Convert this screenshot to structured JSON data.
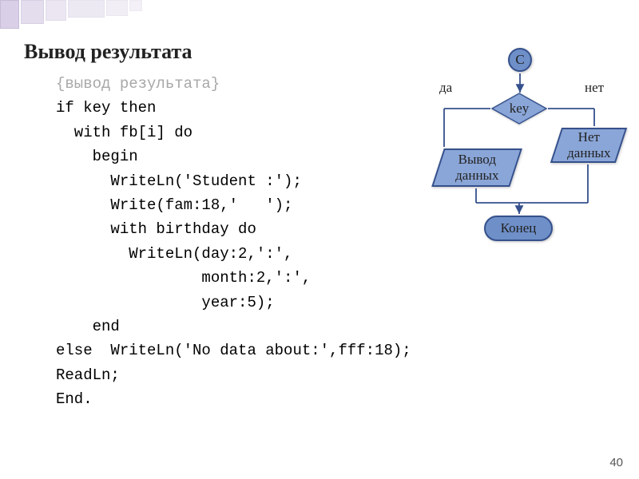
{
  "title": "Вывод результата",
  "code_lines": {
    "l1": "{вывод результата}",
    "l2": "if key then",
    "l3": "  with fb[i] do",
    "l4": "    begin",
    "l5": "      WriteLn('Student :');",
    "l6": "      Write(fam:18,'   ');",
    "l7": "      with birthday do",
    "l8": "        WriteLn(day:2,':',",
    "l9": "                month:2,':',",
    "l10": "                year:5);",
    "l11": "    end",
    "l12": "else  WriteLn('No data about:',fff:18);",
    "l13": "ReadLn;",
    "l14": "End."
  },
  "flow": {
    "connector": "С",
    "decision": "key",
    "yes_label": "да",
    "no_label": "нет",
    "output_box": "Вывод\nданных",
    "nodata_box": "Нет\nданных",
    "end": "Конец"
  },
  "page_number": "40"
}
